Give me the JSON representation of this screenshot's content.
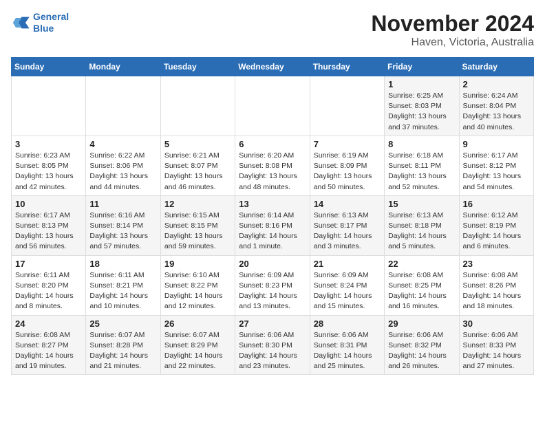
{
  "header": {
    "logo_line1": "General",
    "logo_line2": "Blue",
    "month": "November 2024",
    "location": "Haven, Victoria, Australia"
  },
  "days_of_week": [
    "Sunday",
    "Monday",
    "Tuesday",
    "Wednesday",
    "Thursday",
    "Friday",
    "Saturday"
  ],
  "weeks": [
    [
      {
        "day": "",
        "info": ""
      },
      {
        "day": "",
        "info": ""
      },
      {
        "day": "",
        "info": ""
      },
      {
        "day": "",
        "info": ""
      },
      {
        "day": "",
        "info": ""
      },
      {
        "day": "1",
        "info": "Sunrise: 6:25 AM\nSunset: 8:03 PM\nDaylight: 13 hours and 37 minutes."
      },
      {
        "day": "2",
        "info": "Sunrise: 6:24 AM\nSunset: 8:04 PM\nDaylight: 13 hours and 40 minutes."
      }
    ],
    [
      {
        "day": "3",
        "info": "Sunrise: 6:23 AM\nSunset: 8:05 PM\nDaylight: 13 hours and 42 minutes."
      },
      {
        "day": "4",
        "info": "Sunrise: 6:22 AM\nSunset: 8:06 PM\nDaylight: 13 hours and 44 minutes."
      },
      {
        "day": "5",
        "info": "Sunrise: 6:21 AM\nSunset: 8:07 PM\nDaylight: 13 hours and 46 minutes."
      },
      {
        "day": "6",
        "info": "Sunrise: 6:20 AM\nSunset: 8:08 PM\nDaylight: 13 hours and 48 minutes."
      },
      {
        "day": "7",
        "info": "Sunrise: 6:19 AM\nSunset: 8:09 PM\nDaylight: 13 hours and 50 minutes."
      },
      {
        "day": "8",
        "info": "Sunrise: 6:18 AM\nSunset: 8:11 PM\nDaylight: 13 hours and 52 minutes."
      },
      {
        "day": "9",
        "info": "Sunrise: 6:17 AM\nSunset: 8:12 PM\nDaylight: 13 hours and 54 minutes."
      }
    ],
    [
      {
        "day": "10",
        "info": "Sunrise: 6:17 AM\nSunset: 8:13 PM\nDaylight: 13 hours and 56 minutes."
      },
      {
        "day": "11",
        "info": "Sunrise: 6:16 AM\nSunset: 8:14 PM\nDaylight: 13 hours and 57 minutes."
      },
      {
        "day": "12",
        "info": "Sunrise: 6:15 AM\nSunset: 8:15 PM\nDaylight: 13 hours and 59 minutes."
      },
      {
        "day": "13",
        "info": "Sunrise: 6:14 AM\nSunset: 8:16 PM\nDaylight: 14 hours and 1 minute."
      },
      {
        "day": "14",
        "info": "Sunrise: 6:13 AM\nSunset: 8:17 PM\nDaylight: 14 hours and 3 minutes."
      },
      {
        "day": "15",
        "info": "Sunrise: 6:13 AM\nSunset: 8:18 PM\nDaylight: 14 hours and 5 minutes."
      },
      {
        "day": "16",
        "info": "Sunrise: 6:12 AM\nSunset: 8:19 PM\nDaylight: 14 hours and 6 minutes."
      }
    ],
    [
      {
        "day": "17",
        "info": "Sunrise: 6:11 AM\nSunset: 8:20 PM\nDaylight: 14 hours and 8 minutes."
      },
      {
        "day": "18",
        "info": "Sunrise: 6:11 AM\nSunset: 8:21 PM\nDaylight: 14 hours and 10 minutes."
      },
      {
        "day": "19",
        "info": "Sunrise: 6:10 AM\nSunset: 8:22 PM\nDaylight: 14 hours and 12 minutes."
      },
      {
        "day": "20",
        "info": "Sunrise: 6:09 AM\nSunset: 8:23 PM\nDaylight: 14 hours and 13 minutes."
      },
      {
        "day": "21",
        "info": "Sunrise: 6:09 AM\nSunset: 8:24 PM\nDaylight: 14 hours and 15 minutes."
      },
      {
        "day": "22",
        "info": "Sunrise: 6:08 AM\nSunset: 8:25 PM\nDaylight: 14 hours and 16 minutes."
      },
      {
        "day": "23",
        "info": "Sunrise: 6:08 AM\nSunset: 8:26 PM\nDaylight: 14 hours and 18 minutes."
      }
    ],
    [
      {
        "day": "24",
        "info": "Sunrise: 6:08 AM\nSunset: 8:27 PM\nDaylight: 14 hours and 19 minutes."
      },
      {
        "day": "25",
        "info": "Sunrise: 6:07 AM\nSunset: 8:28 PM\nDaylight: 14 hours and 21 minutes."
      },
      {
        "day": "26",
        "info": "Sunrise: 6:07 AM\nSunset: 8:29 PM\nDaylight: 14 hours and 22 minutes."
      },
      {
        "day": "27",
        "info": "Sunrise: 6:06 AM\nSunset: 8:30 PM\nDaylight: 14 hours and 23 minutes."
      },
      {
        "day": "28",
        "info": "Sunrise: 6:06 AM\nSunset: 8:31 PM\nDaylight: 14 hours and 25 minutes."
      },
      {
        "day": "29",
        "info": "Sunrise: 6:06 AM\nSunset: 8:32 PM\nDaylight: 14 hours and 26 minutes."
      },
      {
        "day": "30",
        "info": "Sunrise: 6:06 AM\nSunset: 8:33 PM\nDaylight: 14 hours and 27 minutes."
      }
    ]
  ]
}
